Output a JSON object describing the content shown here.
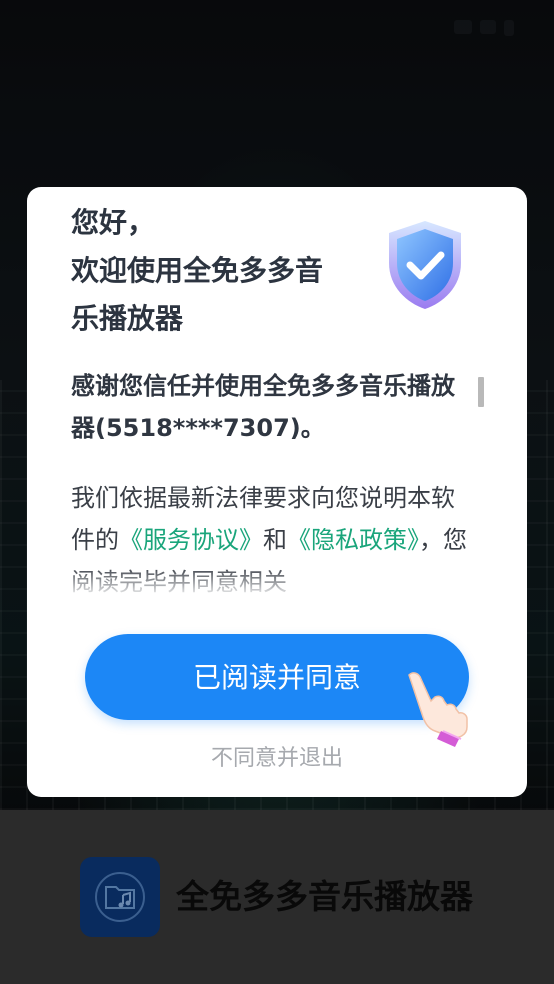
{
  "app": {
    "name": "全免多多音乐播放器"
  },
  "dialog": {
    "greeting_lines": [
      "您好，",
      "欢迎使用全免多多音",
      "乐播放器"
    ],
    "intro": "感谢您信任并使用全免多多音乐播放器(5518****7307)。",
    "body_prefix": "我们依据最新法律要求向您说明本软件的",
    "service_link": "《服务协议》",
    "and_text": "和",
    "privacy_link": "《隐私政策》",
    "body_suffix": "，您阅读完毕并同意相关",
    "agree_label": "已阅读并同意",
    "decline_label": "不同意并退出"
  },
  "colors": {
    "accent": "#1c87f6",
    "link": "#1aa57b",
    "app_icon_bg": "#0d3a7e"
  },
  "icons": {
    "shield": "shield-check-icon",
    "hand": "pointing-hand-icon",
    "app": "music-folder-icon"
  }
}
